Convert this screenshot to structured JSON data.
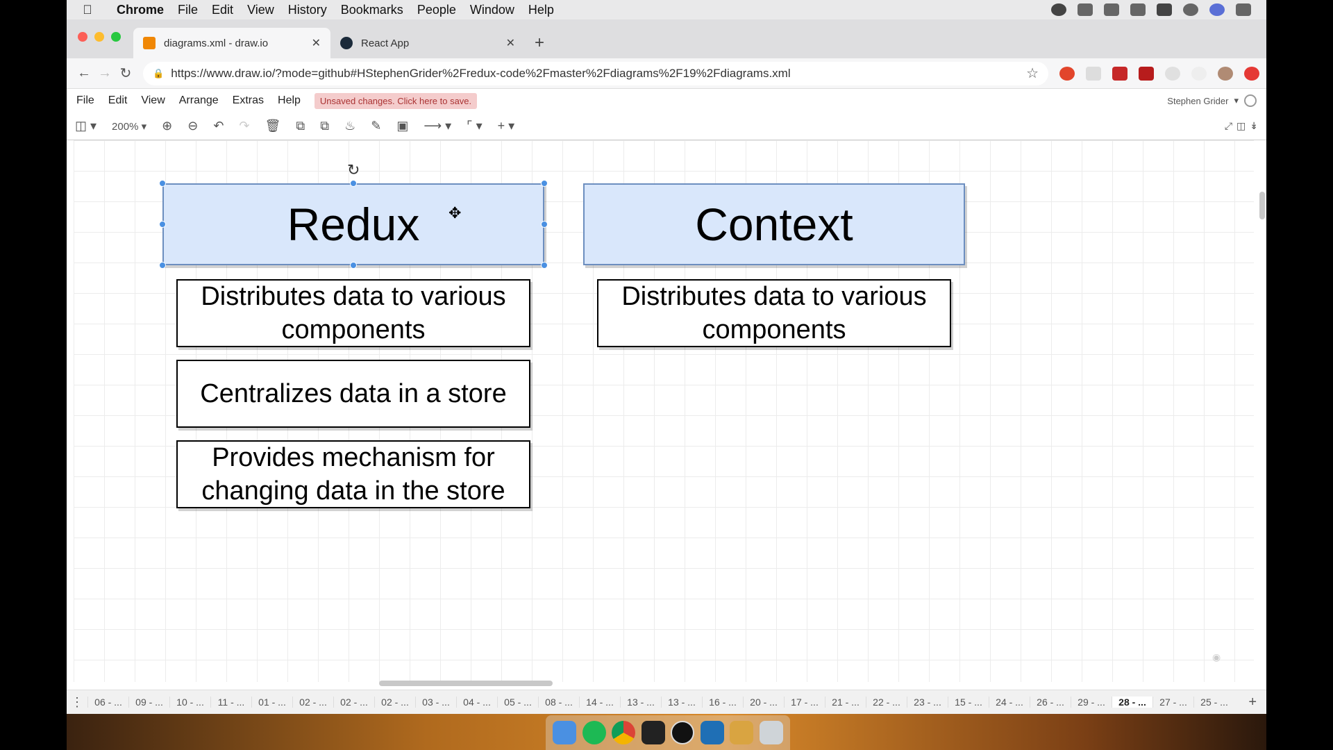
{
  "macos": {
    "app_name": "Chrome",
    "menus": [
      "File",
      "Edit",
      "View",
      "History",
      "Bookmarks",
      "People",
      "Window",
      "Help"
    ],
    "tray_icons": [
      "opera-icon",
      "glasses-icon",
      "docker-icon",
      "wifi-icon",
      "battery-icon",
      "spotlight-search-icon",
      "siri-icon",
      "notification-center-icon"
    ]
  },
  "browser": {
    "tabs": [
      {
        "title": "diagrams.xml - draw.io",
        "active": true,
        "favicon_color": "#f08705"
      },
      {
        "title": "React App",
        "active": false,
        "favicon_color": "#1b2a3a"
      }
    ],
    "url": "https://www.draw.io/?mode=github#HStephenGrider%2Fredux-code%2Fmaster%2Fdiagrams%2F19%2Fdiagrams.xml",
    "extension_icons": [
      "extension-red-icon",
      "css-extension-icon",
      "extension-lastpass-icon",
      "extension-ublock-icon",
      "extension-gray-icon",
      "extension-gray-2-icon",
      "profile-avatar-icon",
      "extension-red-circle-icon"
    ]
  },
  "drawio": {
    "menus": [
      "File",
      "Edit",
      "View",
      "Arrange",
      "Extras",
      "Help"
    ],
    "unsaved_notice": "Unsaved changes. Click here to save.",
    "user_name": "Stephen Grider",
    "zoom": "200%",
    "toolbar_icons": [
      "format-panel-icon",
      "zoom-in-icon",
      "zoom-out-icon",
      "undo-icon",
      "redo-icon",
      "delete-icon",
      "to-front-icon",
      "to-back-icon",
      "fill-color-icon",
      "line-color-icon",
      "shadow-icon",
      "connection-icon",
      "waypoints-icon",
      "insert-icon"
    ],
    "shapes": {
      "redux_header": "Redux",
      "context_header": "Context",
      "redux_item_1": "Distributes data to various components",
      "redux_item_2": "Centralizes data in a store",
      "redux_item_3": "Provides mechanism for changing data in the store",
      "context_item_1": "Distributes data to various components"
    },
    "colors": {
      "header_fill": "#d9e7fb",
      "header_stroke": "#6c8ebf",
      "selection": "#4a90e2"
    },
    "pages": [
      "06 - ...",
      "09 - ...",
      "10 - ...",
      "11 - ...",
      "01 - ...",
      "02 - ...",
      "02 - ...",
      "02 - ...",
      "03 - ...",
      "04 - ...",
      "05 - ...",
      "08 - ...",
      "14 - ...",
      "13 - ...",
      "13 - ...",
      "16 - ...",
      "20 - ...",
      "17 - ...",
      "21 - ...",
      "22 - ...",
      "23 - ...",
      "15 - ...",
      "24 - ...",
      "26 - ...",
      "29 - ...",
      "28 - ...",
      "27 - ...",
      "25 - ..."
    ],
    "active_page": "28 - ..."
  },
  "dock_apps": [
    "finder-icon",
    "spotify-icon",
    "chrome-icon",
    "terminal-icon",
    "obs-icon",
    "vscode-icon",
    "sequel-pro-icon",
    "trash-icon"
  ]
}
